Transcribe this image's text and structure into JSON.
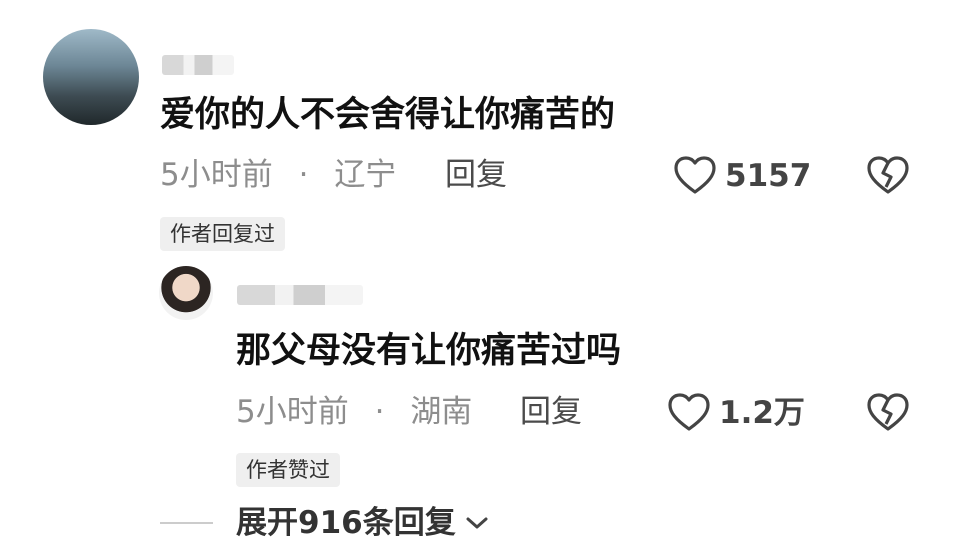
{
  "comment": {
    "text": "爱你的人不会舍得让你痛苦的",
    "time": "5小时前",
    "separator": "·",
    "location": "辽宁",
    "reply_label": "回复",
    "likes": "5157",
    "badge": "作者回复过"
  },
  "reply": {
    "text": "那父母没有让你痛苦过吗",
    "time": "5小时前",
    "separator": "·",
    "location": "湖南",
    "reply_label": "回复",
    "likes": "1.2万",
    "badge": "作者赞过"
  },
  "expand_label": "展开916条回复",
  "icons": {
    "like": "heart-icon",
    "dislike": "broken-heart-icon",
    "expand": "chevron-down-icon"
  }
}
